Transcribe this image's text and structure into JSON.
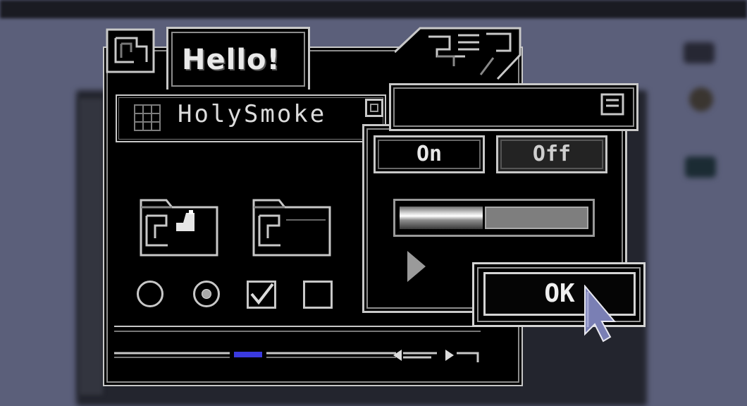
{
  "window": {
    "title": "Hello!"
  },
  "field": {
    "value": "HolySmoke"
  },
  "panel": {
    "on_label": "On",
    "off_label": "Off",
    "progress": 0.44,
    "ok_label": "OK"
  },
  "radios": [
    {
      "selected": false
    },
    {
      "selected": true
    }
  ],
  "checkboxes": [
    {
      "checked": true
    },
    {
      "checked": false
    }
  ],
  "colors": {
    "frame": "#c8c8c8",
    "accent_scroll": "#3a3adf",
    "cursor": "#7a7fb4",
    "desktop": "#5b5f7a"
  },
  "icons": [
    "grid-icon",
    "folder-icon",
    "menu-icon",
    "play-icon",
    "pointer-cursor-icon"
  ]
}
